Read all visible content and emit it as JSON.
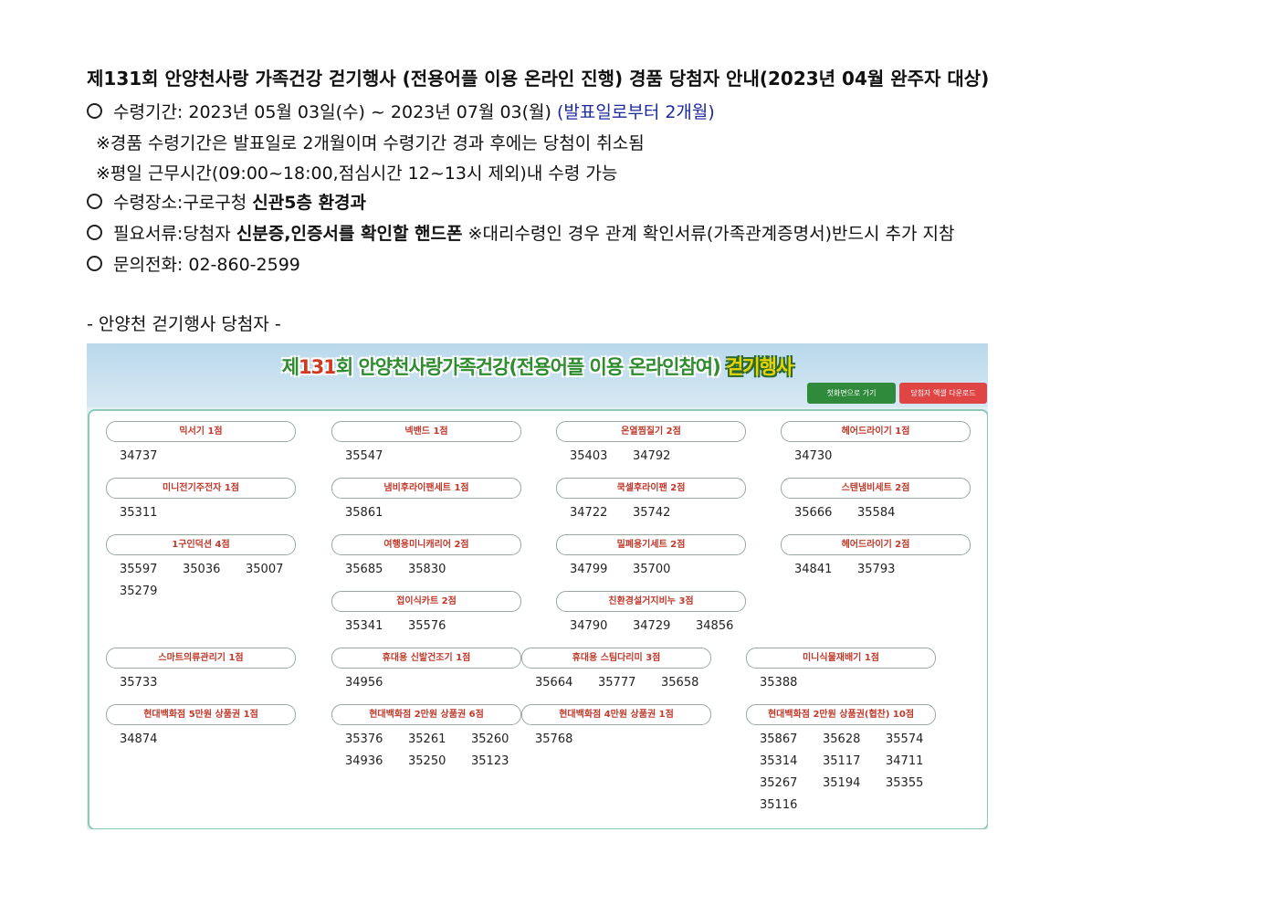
{
  "document": {
    "title": "제131회 안양천사랑 가족건강 걷기행사 (전용어플 이용 온라인 진행) 경품 당첨자 안내(2023년 04월 완주자 대상)",
    "period_label": "수령기간: 2023년 05월 03일(수) ~ 2023년 07월 03(월)",
    "period_note": "(발표일로부터 2개월)",
    "note1": "※경품 수령기간은 발표일로 2개월이며 수령기간 경과 후에는 당첨이 취소됨",
    "note2": "※평일 근무시간(09:00~18:00,점심시간 12~13시 제외)내 수령 가능",
    "place_label": "수령장소:구로구청 ",
    "place_bold": "신관5층 환경과",
    "docs_label": "필요서류:당첨자 ",
    "docs_bold": "신분증,인증서를 확인할 핸드폰",
    "docs_note": " ※대리수령인 경우 관계 확인서류(가족관계증명서)반드시 추가 지참",
    "contact": "문의전화: 02-860-2599",
    "section_title": "- 안양천 걷기행사 당첨자 -"
  },
  "screenshot": {
    "banner_prefix": "제",
    "banner_number": "131",
    "banner_middle": "회 안양천사랑가족건강(전용어플 이용 온라인참여) ",
    "banner_walk": "걷기행사",
    "home_button": "첫화면으로 가기",
    "excel_button": "당첨자 엑셀 다운로드",
    "prizes": [
      {
        "name": "믹서기 1점",
        "winners": [
          "34737"
        ]
      },
      {
        "name": "넥밴드 1점",
        "winners": [
          "35547"
        ]
      },
      {
        "name": "온열찜질기 2점",
        "winners": [
          "35403",
          "34792"
        ]
      },
      {
        "name": "헤어드라이기 1점",
        "winners": [
          "34730"
        ]
      },
      {
        "name": "미니전기주전자 1점",
        "winners": [
          "35311"
        ]
      },
      {
        "name": "냄비후라이팬세트 1점",
        "winners": [
          "35861"
        ]
      },
      {
        "name": "쿡셀후라이팬 2점",
        "winners": [
          "34722",
          "35742"
        ]
      },
      {
        "name": "스텐냄비세트 2점",
        "winners": [
          "35666",
          "35584"
        ]
      },
      {
        "name": "1구인덕션 4점",
        "winners": [
          "35597",
          "35036",
          "35007",
          "35279"
        ]
      },
      {
        "name": "여행용미니캐리어 2점",
        "winners": [
          "35685",
          "35830"
        ]
      },
      {
        "name": "밀폐용기세트 2점",
        "winners": [
          "34799",
          "35700"
        ]
      },
      {
        "name": "헤어드라이기 2점",
        "winners": [
          "34841",
          "35793"
        ]
      },
      {
        "name": "접이식카트 2점",
        "winners": [
          "35341",
          "35576"
        ]
      },
      {
        "name": "친환경설거지비누 3점",
        "winners": [
          "34790",
          "34729",
          "34856"
        ]
      },
      {
        "name": "스마트의류관리기 1점",
        "winners": [
          "35733"
        ]
      },
      {
        "name": "휴대용 신발건조기 1점",
        "winners": [
          "34956"
        ]
      },
      {
        "name": "휴대용 스팀다리미 3점",
        "winners": [
          "35664",
          "35777",
          "35658"
        ]
      },
      {
        "name": "미니식물재배기 1점",
        "winners": [
          "35388"
        ]
      },
      {
        "name": "현대백화점 5만원 상품권 1점",
        "winners": [
          "34874"
        ]
      },
      {
        "name": "현대백화점 2만원 상품권 6점",
        "winners": [
          "35376",
          "35261",
          "35260",
          "34936",
          "35250",
          "35123"
        ]
      },
      {
        "name": "현대백화점 4만원 상품권 1점",
        "winners": [
          "35768"
        ]
      },
      {
        "name": "현대백화점 2만원 상품권(협찬) 10점",
        "winners": [
          "35867",
          "35628",
          "35574",
          "35314",
          "35117",
          "34711",
          "35267",
          "35194",
          "35355",
          "35116"
        ]
      }
    ]
  },
  "colors": {
    "period_note": "#1d2a9e",
    "prize_text": "#c0392b",
    "home_button": "#2f8a3b",
    "excel_button": "#e04545",
    "board_border": "#8ccab8"
  }
}
